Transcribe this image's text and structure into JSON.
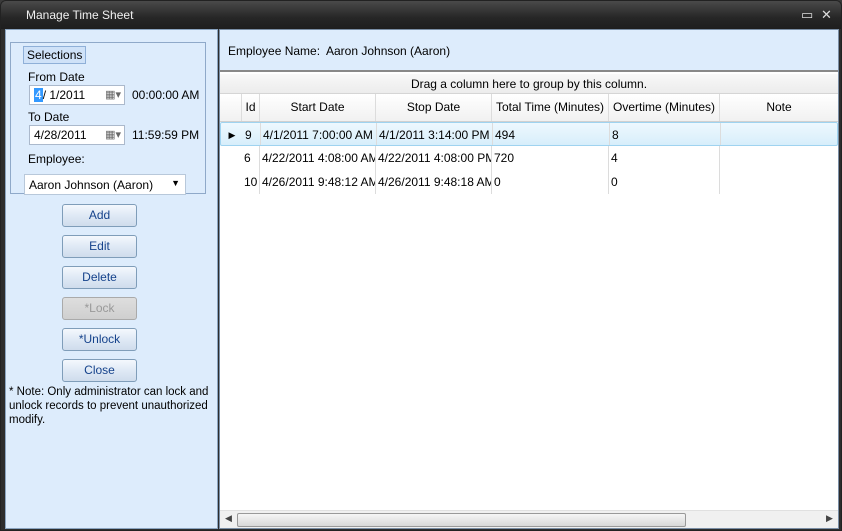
{
  "window": {
    "title": "Manage Time Sheet",
    "minimize_icon": "minimize-icon",
    "close_icon": "close-icon"
  },
  "selections": {
    "legend": "Selections",
    "from_label": "From Date",
    "from_month": "4",
    "from_rest": "/  1/2011",
    "from_time": "00:00:00 AM",
    "to_label": "To Date",
    "to_value": "4/28/2011",
    "to_time": "11:59:59 PM",
    "employee_label": "Employee:",
    "employee_value": "Aaron Johnson (Aaron)"
  },
  "buttons": {
    "add": "Add",
    "edit": "Edit",
    "delete": "Delete",
    "lock": "*Lock",
    "unlock": "*Unlock",
    "close": "Close"
  },
  "note": "* Note: Only administrator can lock and unlock records to prevent unauthorized modify.",
  "header": {
    "label": "Employee Name:",
    "value": "Aaron Johnson (Aaron)"
  },
  "grid": {
    "group_hint": "Drag a column here to group by this column.",
    "columns": [
      "Id",
      "Start Date",
      "Stop Date",
      "Total Time (Minutes)",
      "Overtime (Minutes)",
      "Note"
    ],
    "rows": [
      {
        "id": "9",
        "start": "4/1/2011 7:00:00 AM",
        "stop": "4/1/2011 3:14:00 PM",
        "total": "494",
        "overtime": "8",
        "note": ""
      },
      {
        "id": "6",
        "start": "4/22/2011 4:08:00 AM",
        "stop": "4/22/2011 4:08:00 PM",
        "total": "720",
        "overtime": "4",
        "note": ""
      },
      {
        "id": "10",
        "start": "4/26/2011 9:48:12 AM",
        "stop": "4/26/2011 9:48:18 AM",
        "total": "0",
        "overtime": "0",
        "note": ""
      }
    ],
    "current_row_indicator": "▶"
  }
}
